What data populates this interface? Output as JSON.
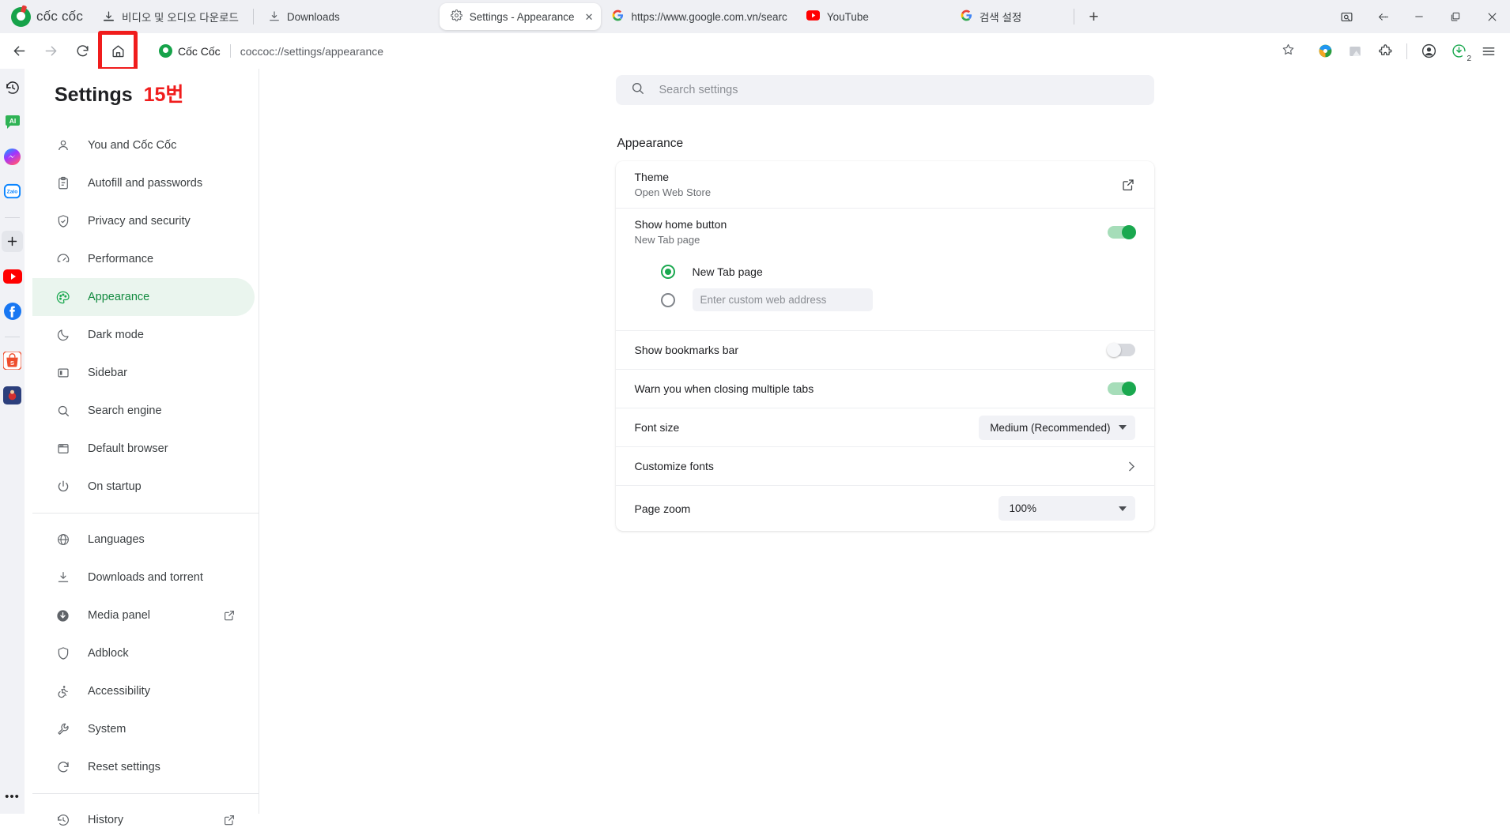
{
  "browser": {
    "brand": "cốc cốc",
    "quick_tabs": [
      {
        "label": "비디오 및 오디오 다운로드",
        "icon": "download-video-icon"
      },
      {
        "label": "Downloads",
        "icon": "download-icon"
      }
    ],
    "tabs": [
      {
        "title": "Settings - Appearance",
        "icon": "gear-icon",
        "active": true,
        "close": "✕"
      },
      {
        "title": "https://www.google.com.vn/searc",
        "icon": "google-icon",
        "active": false
      },
      {
        "title": "YouTube",
        "icon": "youtube-icon",
        "active": false
      },
      {
        "title": "검색 설정",
        "icon": "google-icon",
        "active": false
      }
    ],
    "new_tab_label": "+",
    "window_controls": [
      "screenshot-icon",
      "back-arrow-icon",
      "minimize-icon",
      "maximize-icon",
      "close-icon"
    ],
    "omnibox": {
      "site_name": "Cốc Cốc",
      "url": "coccoc://settings/appearance",
      "star": "bookmark-star-icon"
    },
    "nav": {
      "back": "back-icon",
      "forward": "forward-icon",
      "reload": "reload-icon",
      "home": "home-icon"
    },
    "extensions": [
      "idm-icon",
      "screenshot-extension-icon",
      "extensions-puzzle-icon",
      "profile-icon",
      "downloads-icon",
      "menu-icon"
    ],
    "download_badge": "2",
    "highlight_color": "#f01c1c"
  },
  "rail": {
    "items": [
      {
        "name": "history-icon",
        "label": "History"
      },
      {
        "name": "ai-chat-icon",
        "label": "AI"
      },
      {
        "name": "messenger-icon",
        "label": "Messenger"
      },
      {
        "name": "zalo-icon",
        "label": "Zalo"
      },
      {
        "name": "add-panel-icon",
        "label": "+"
      },
      {
        "name": "youtube-icon",
        "label": "YouTube"
      },
      {
        "name": "facebook-icon",
        "label": "Facebook"
      },
      {
        "name": "shopee-icon",
        "label": "Shopee"
      },
      {
        "name": "game-icon",
        "label": "Game"
      }
    ],
    "more": "•••"
  },
  "settings": {
    "title": "Settings",
    "annotation": "15번",
    "search": {
      "placeholder": "Search settings",
      "icon": "search-icon"
    },
    "nav_groups": [
      {
        "items": [
          {
            "label": "You and Cốc Cốc",
            "icon": "person-icon",
            "selected": false
          },
          {
            "label": "Autofill and passwords",
            "icon": "clipboard-icon",
            "selected": false
          },
          {
            "label": "Privacy and security",
            "icon": "shield-check-icon",
            "selected": false
          },
          {
            "label": "Performance",
            "icon": "speedometer-icon",
            "selected": false
          },
          {
            "label": "Appearance",
            "icon": "palette-icon",
            "selected": true
          },
          {
            "label": "Dark mode",
            "icon": "moon-icon",
            "selected": false
          },
          {
            "label": "Sidebar",
            "icon": "sidebar-icon",
            "selected": false
          },
          {
            "label": "Search engine",
            "icon": "search-icon",
            "selected": false
          },
          {
            "label": "Default browser",
            "icon": "browser-window-icon",
            "selected": false
          },
          {
            "label": "On startup",
            "icon": "power-icon",
            "selected": false
          }
        ]
      },
      {
        "items": [
          {
            "label": "Languages",
            "icon": "globe-icon",
            "selected": false
          },
          {
            "label": "Downloads and torrent",
            "icon": "download-icon",
            "selected": false
          },
          {
            "label": "Media panel",
            "icon": "media-download-icon",
            "selected": false,
            "external": true
          },
          {
            "label": "Adblock",
            "icon": "shield-icon",
            "selected": false
          },
          {
            "label": "Accessibility",
            "icon": "accessibility-icon",
            "selected": false
          },
          {
            "label": "System",
            "icon": "wrench-icon",
            "selected": false
          },
          {
            "label": "Reset settings",
            "icon": "refresh-icon",
            "selected": false
          }
        ]
      },
      {
        "items": [
          {
            "label": "History",
            "icon": "history-icon",
            "selected": false,
            "external": true
          }
        ]
      }
    ],
    "appearance": {
      "heading": "Appearance",
      "theme": {
        "label": "Theme",
        "sub": "Open Web Store",
        "action_icon": "external-link-icon"
      },
      "home_button": {
        "label": "Show home button",
        "sub": "New Tab page",
        "enabled": true,
        "options": [
          {
            "label": "New Tab page",
            "selected": true
          },
          {
            "label": "",
            "selected": false,
            "placeholder": "Enter custom web address"
          }
        ]
      },
      "bookmarks_bar": {
        "label": "Show bookmarks bar",
        "enabled": false
      },
      "warn_closing": {
        "label": "Warn you when closing multiple tabs",
        "enabled": true
      },
      "font_size": {
        "label": "Font size",
        "value": "Medium (Recommended)"
      },
      "customize_fonts": {
        "label": "Customize fonts",
        "chevron": "chevron-right-icon"
      },
      "page_zoom": {
        "label": "Page zoom",
        "value": "100%"
      }
    }
  }
}
